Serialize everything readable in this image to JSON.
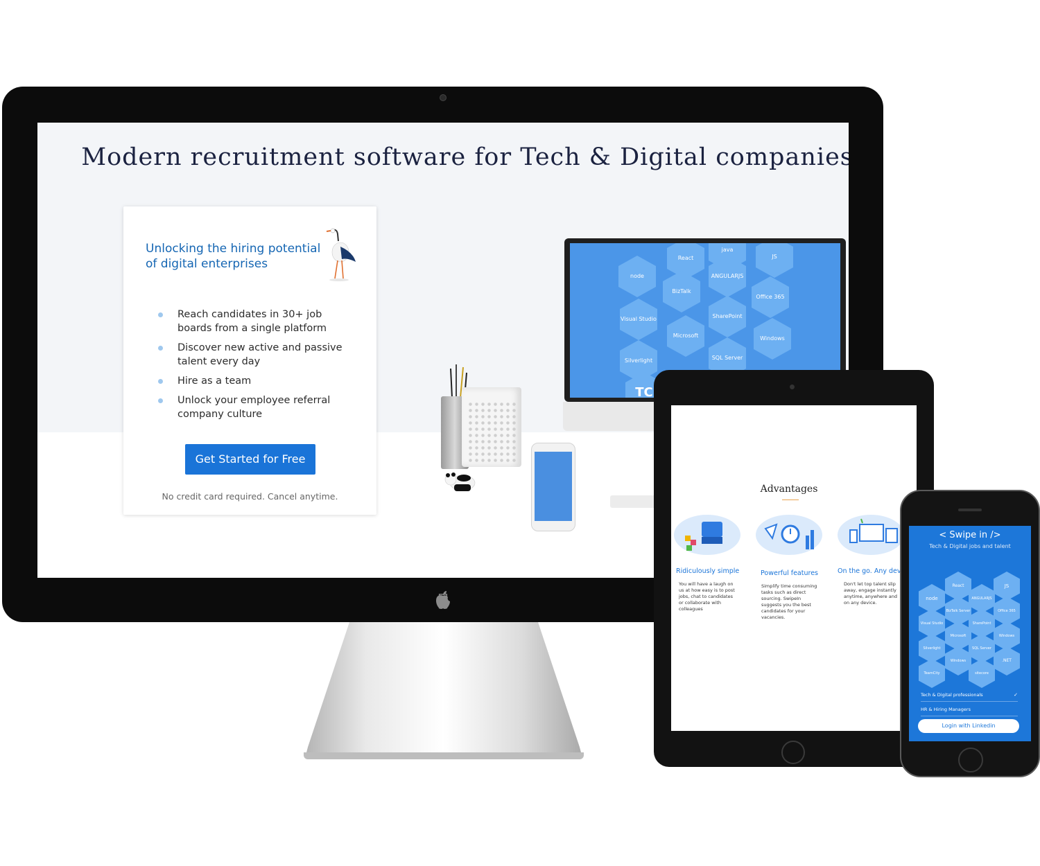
{
  "desktop": {
    "title": "Modern recruitment software for Tech & Digital companies",
    "card": {
      "heading": "Unlocking the hiring potential of digital enterprises",
      "bullets": [
        "Reach candidates in 30+ job boards from a single platform",
        "Discover new active and passive talent every day",
        "Hire as a team",
        "Unlock your employee referral company culture"
      ],
      "cta_label": "Get Started for Free",
      "note": "No credit card required. Cancel anytime."
    },
    "tech_tiles": [
      "node",
      "React",
      "java",
      "JS",
      "ANGULARJS",
      "BizTalk Server",
      "Office 365",
      "Visual Studio",
      "Microsoft Dynamics",
      "SharePoint",
      "Windows",
      "Silverlight",
      "SQL Server",
      "TC"
    ]
  },
  "tablet": {
    "section_title": "Advantages",
    "features": [
      {
        "title": "Ridiculously simple",
        "text": "You will have a laugh on us at how easy is to post jobs, chat to candidates or collaborate with colleagues"
      },
      {
        "title": "Powerful features",
        "text": "Simplify time consuming tasks such as direct sourcing. SwipeIn suggests you the best candidates for your vacancies."
      },
      {
        "title": "On the go. Any devi",
        "text": "Don't let top talent slip away, engage instantly anytime, anywhere and on any device."
      }
    ]
  },
  "phone": {
    "logo": "< Swipe in />",
    "tagline": "Tech & Digital jobs and talent",
    "tiles": [
      "node",
      "React",
      "ANGULARJS",
      "JS",
      "BizTalk Server",
      "Office 365",
      "Visual Studio",
      "SharePoint",
      "Microsoft Dynamics",
      "Windows",
      "Silverlight",
      "SQL Server",
      "Windows Azure",
      ".NET",
      "TeamCity",
      "sitecore"
    ],
    "options": [
      "Tech & Digital professionals",
      "HR & Hiring Managers"
    ],
    "check": "✓",
    "login_label": "Login with Linkedin"
  },
  "icons": {
    "apple_logo": "apple-logo-icon",
    "stork": "stork-illustration",
    "panda": "panda-figurine"
  }
}
